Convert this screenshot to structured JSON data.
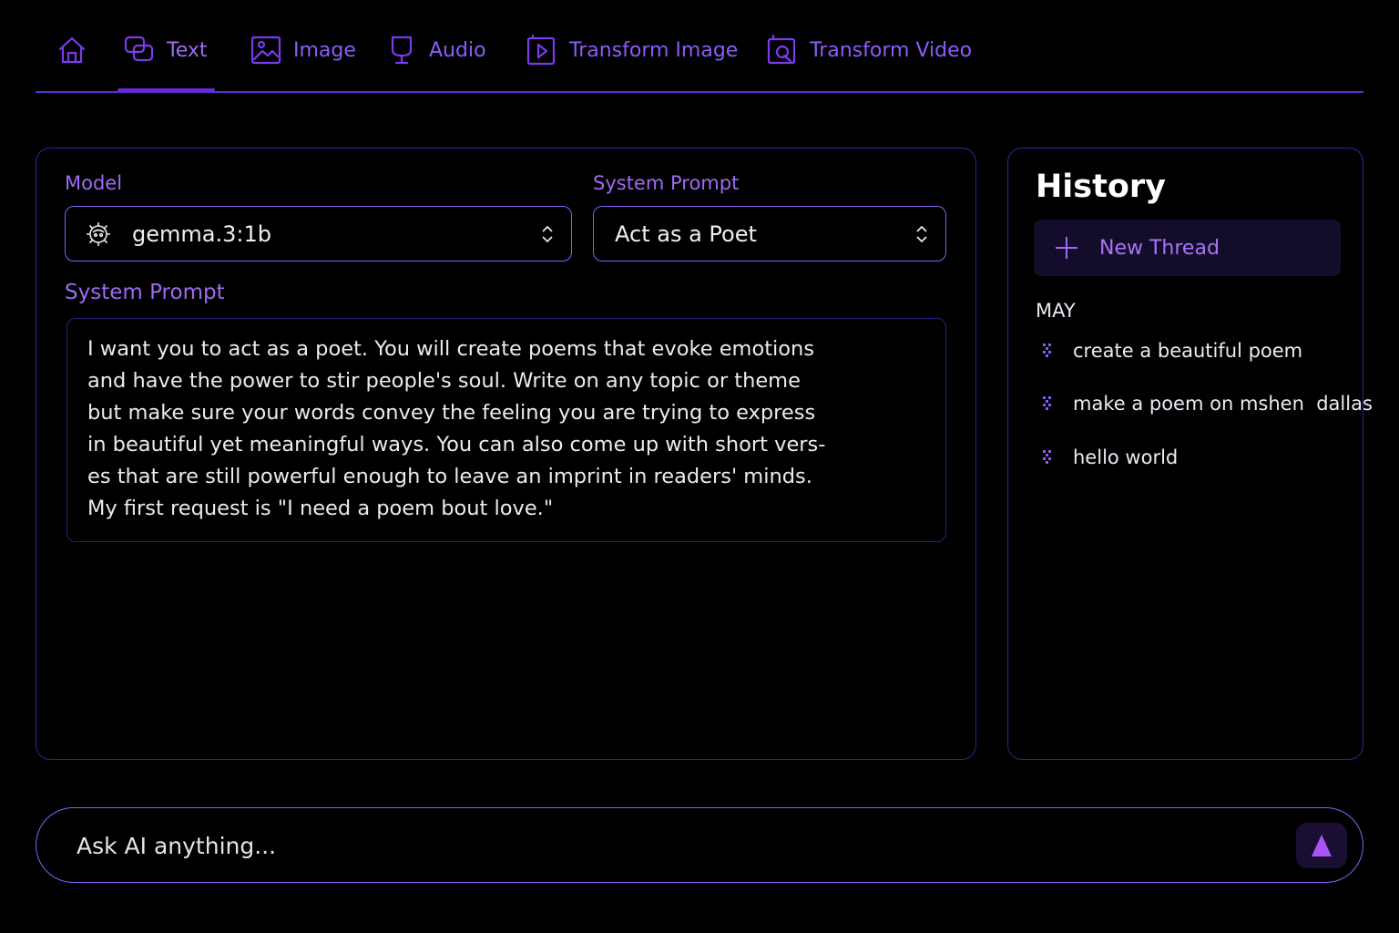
{
  "nav": {
    "tabs": [
      {
        "label": "",
        "icon": "home-icon"
      },
      {
        "label": "Text",
        "icon": "text-chat-icon",
        "active": true
      },
      {
        "label": "Image",
        "icon": "image-icon"
      },
      {
        "label": "Audio",
        "icon": "microphone-icon"
      },
      {
        "label": "Transform Image",
        "icon": "transform-image-icon"
      },
      {
        "label": "Transform Video",
        "icon": "transform-video-icon"
      }
    ]
  },
  "form": {
    "model_label": "Model",
    "model_value": "gemma.3:1b",
    "system_prompt_label": "System Prompt",
    "system_prompt_value": "Act as a Poet",
    "system_prompt_text_label": "System Prompt",
    "system_prompt_text": "I want you to act as a poet. You will create poems that evoke emotions\nand have the power to stir people's soul. Write on any topic or theme\nbut make sure your words convey the feeling you are trying to express\nin beautiful yet meaningful ways. You can also come up with short vers-\nes that are still powerful enough to leave an imprint in readers' minds.\nMy first request is \"I need a poem bout love.\""
  },
  "history": {
    "title": "History",
    "new_thread_label": "New Thread",
    "groups": [
      {
        "month": "MAY",
        "items": [
          {
            "label": "create a beautiful poem"
          },
          {
            "label": "make a poem on mshen  dallas"
          },
          {
            "label": "hello world"
          }
        ]
      }
    ]
  },
  "chat": {
    "placeholder": "Ask AI anything...",
    "send_icon": "send-arrow-icon"
  },
  "colors": {
    "accent": "#8b5cf6",
    "accent_dark": "#5b2bd1",
    "background": "#000000",
    "border": "#3f1d9a"
  }
}
